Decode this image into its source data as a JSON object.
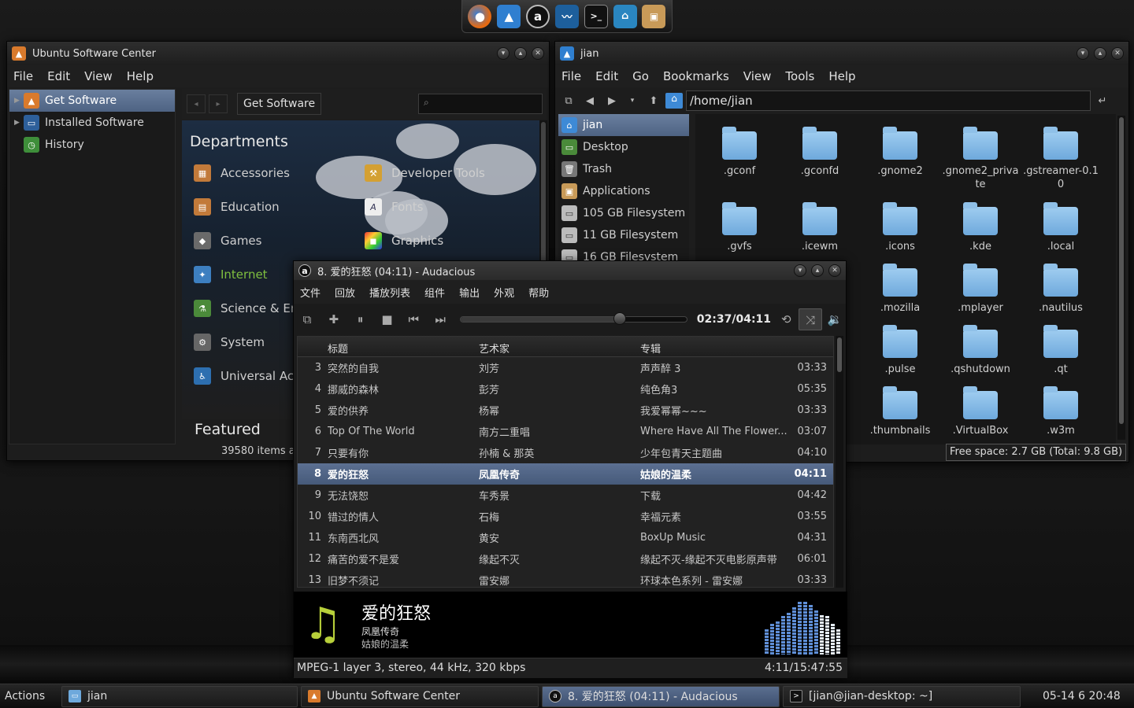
{
  "dock": [
    "firefox-icon",
    "arch-icon",
    "audacious-icon",
    "system-monitor-icon",
    "terminal-icon",
    "network-icon",
    "package-icon"
  ],
  "usc": {
    "title": "Ubuntu Software Center",
    "menu": [
      "File",
      "Edit",
      "View",
      "Help"
    ],
    "sidebar": [
      {
        "label": "Get Software",
        "selected": true
      },
      {
        "label": "Installed Software"
      },
      {
        "label": "History"
      }
    ],
    "breadcrumb": "Get Software",
    "search_placeholder": "",
    "departments_title": "Departments",
    "departments_left": [
      "Accessories",
      "Education",
      "Games",
      "Internet",
      "Science & Eng",
      "System",
      "Universal Acce"
    ],
    "departments_right": [
      "Developer Tools",
      "Fonts",
      "Graphics"
    ],
    "featured": "Featured",
    "status": "39580 items a"
  },
  "fm": {
    "title": "jian",
    "menu": [
      "File",
      "Edit",
      "Go",
      "Bookmarks",
      "View",
      "Tools",
      "Help"
    ],
    "path": "/home/jian",
    "places": [
      {
        "label": "jian",
        "selected": true
      },
      {
        "label": "Desktop"
      },
      {
        "label": "Trash"
      },
      {
        "label": "Applications"
      },
      {
        "label": "105 GB Filesystem"
      },
      {
        "label": "11 GB Filesystem"
      },
      {
        "label": "16 GB Filesystem"
      }
    ],
    "folders": [
      ".gconf",
      ".gconfd",
      ".gnome2",
      ".gnome2_private",
      ".gstreamer-0.10",
      ".gvfs",
      ".icewm",
      ".icons",
      ".kde",
      ".local",
      ".mozilla",
      ".mplayer",
      ".nautilus",
      ".pulse",
      ".qshutdown",
      ".qt",
      ".thumbnails",
      ".VirtualBox",
      ".w3m"
    ],
    "status": "Free space: 2.7 GB (Total: 9.8 GB)"
  },
  "aud": {
    "title": "8. 爱的狂怒 (04:11) - Audacious",
    "menu": [
      "文件",
      "回放",
      "播放列表",
      "组件",
      "输出",
      "外观",
      "帮助"
    ],
    "time": "02:37/04:11",
    "progress": 0.7,
    "headers": [
      "标题",
      "艺术家",
      "专辑"
    ],
    "rows": [
      {
        "n": "3",
        "title": "突然的自我",
        "artist": "刘芳",
        "album": "声声醉 3",
        "len": "03:33"
      },
      {
        "n": "4",
        "title": "挪威的森林",
        "artist": "彭芳",
        "album": "纯色角3",
        "len": "05:35"
      },
      {
        "n": "5",
        "title": "爱的供养",
        "artist": "杨幂",
        "album": "我爱幂幂~~~",
        "len": "03:33"
      },
      {
        "n": "6",
        "title": "Top Of The World",
        "artist": "南方二重唱",
        "album": "Where Have All The Flower...",
        "len": "03:07"
      },
      {
        "n": "7",
        "title": "只要有你",
        "artist": "孙楠 & 那英",
        "album": "少年包青天主题曲",
        "len": "04:10"
      },
      {
        "n": "8",
        "title": "爱的狂怒",
        "artist": "凤凰传奇",
        "album": "姑娘的温柔",
        "len": "04:11",
        "selected": true
      },
      {
        "n": "9",
        "title": "无法饶恕",
        "artist": "车秀景",
        "album": "下载",
        "len": "04:42"
      },
      {
        "n": "10",
        "title": "错过的情人",
        "artist": "石梅",
        "album": "幸福元素",
        "len": "03:55"
      },
      {
        "n": "11",
        "title": "东南西北风",
        "artist": "黄安",
        "album": "BoxUp Music",
        "len": "04:31"
      },
      {
        "n": "12",
        "title": "痛苦的爱不是爱",
        "artist": "缘起不灭",
        "album": "缘起不灭-缘起不灭电影原声带",
        "len": "06:01"
      },
      {
        "n": "13",
        "title": "旧梦不须记",
        "artist": "雷安娜",
        "album": "环球本色系列 - 雷安娜",
        "len": "03:33"
      }
    ],
    "now_title": "爱的狂怒",
    "now_artist": "凤凰传奇",
    "now_album": "姑娘的温柔",
    "vis_levels": [
      0.45,
      0.55,
      0.6,
      0.7,
      0.75,
      0.85,
      0.95,
      0.95,
      0.9,
      0.8,
      0.72,
      0.7,
      0.55,
      0.45
    ],
    "info": "MPEG-1 layer 3, stereo, 44 kHz, 320 kbps",
    "info_right": "4:11/15:47:55"
  },
  "taskbar": {
    "actions": "Actions",
    "tasks": [
      "jian",
      "Ubuntu Software Center",
      "8. 爱的狂怒 (04:11) - Audacious",
      "[jian@jian-desktop: ~]"
    ],
    "clock": "05-14 6 20:48"
  },
  "colors": {
    "selection": "#5c7092",
    "folder": "#8fc0e8",
    "internet": "#7fbf3f"
  }
}
